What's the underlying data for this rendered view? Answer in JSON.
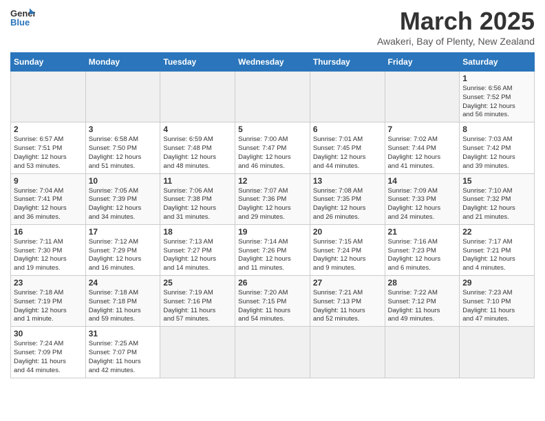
{
  "header": {
    "logo_general": "General",
    "logo_blue": "Blue",
    "month_title": "March 2025",
    "subtitle": "Awakeri, Bay of Plenty, New Zealand"
  },
  "days_of_week": [
    "Sunday",
    "Monday",
    "Tuesday",
    "Wednesday",
    "Thursday",
    "Friday",
    "Saturday"
  ],
  "weeks": [
    [
      {
        "day": "",
        "info": ""
      },
      {
        "day": "",
        "info": ""
      },
      {
        "day": "",
        "info": ""
      },
      {
        "day": "",
        "info": ""
      },
      {
        "day": "",
        "info": ""
      },
      {
        "day": "",
        "info": ""
      },
      {
        "day": "1",
        "info": "Sunrise: 6:56 AM\nSunset: 7:52 PM\nDaylight: 12 hours\nand 56 minutes."
      }
    ],
    [
      {
        "day": "2",
        "info": "Sunrise: 6:57 AM\nSunset: 7:51 PM\nDaylight: 12 hours\nand 53 minutes."
      },
      {
        "day": "3",
        "info": "Sunrise: 6:58 AM\nSunset: 7:50 PM\nDaylight: 12 hours\nand 51 minutes."
      },
      {
        "day": "4",
        "info": "Sunrise: 6:59 AM\nSunset: 7:48 PM\nDaylight: 12 hours\nand 48 minutes."
      },
      {
        "day": "5",
        "info": "Sunrise: 7:00 AM\nSunset: 7:47 PM\nDaylight: 12 hours\nand 46 minutes."
      },
      {
        "day": "6",
        "info": "Sunrise: 7:01 AM\nSunset: 7:45 PM\nDaylight: 12 hours\nand 44 minutes."
      },
      {
        "day": "7",
        "info": "Sunrise: 7:02 AM\nSunset: 7:44 PM\nDaylight: 12 hours\nand 41 minutes."
      },
      {
        "day": "8",
        "info": "Sunrise: 7:03 AM\nSunset: 7:42 PM\nDaylight: 12 hours\nand 39 minutes."
      }
    ],
    [
      {
        "day": "9",
        "info": "Sunrise: 7:04 AM\nSunset: 7:41 PM\nDaylight: 12 hours\nand 36 minutes."
      },
      {
        "day": "10",
        "info": "Sunrise: 7:05 AM\nSunset: 7:39 PM\nDaylight: 12 hours\nand 34 minutes."
      },
      {
        "day": "11",
        "info": "Sunrise: 7:06 AM\nSunset: 7:38 PM\nDaylight: 12 hours\nand 31 minutes."
      },
      {
        "day": "12",
        "info": "Sunrise: 7:07 AM\nSunset: 7:36 PM\nDaylight: 12 hours\nand 29 minutes."
      },
      {
        "day": "13",
        "info": "Sunrise: 7:08 AM\nSunset: 7:35 PM\nDaylight: 12 hours\nand 26 minutes."
      },
      {
        "day": "14",
        "info": "Sunrise: 7:09 AM\nSunset: 7:33 PM\nDaylight: 12 hours\nand 24 minutes."
      },
      {
        "day": "15",
        "info": "Sunrise: 7:10 AM\nSunset: 7:32 PM\nDaylight: 12 hours\nand 21 minutes."
      }
    ],
    [
      {
        "day": "16",
        "info": "Sunrise: 7:11 AM\nSunset: 7:30 PM\nDaylight: 12 hours\nand 19 minutes."
      },
      {
        "day": "17",
        "info": "Sunrise: 7:12 AM\nSunset: 7:29 PM\nDaylight: 12 hours\nand 16 minutes."
      },
      {
        "day": "18",
        "info": "Sunrise: 7:13 AM\nSunset: 7:27 PM\nDaylight: 12 hours\nand 14 minutes."
      },
      {
        "day": "19",
        "info": "Sunrise: 7:14 AM\nSunset: 7:26 PM\nDaylight: 12 hours\nand 11 minutes."
      },
      {
        "day": "20",
        "info": "Sunrise: 7:15 AM\nSunset: 7:24 PM\nDaylight: 12 hours\nand 9 minutes."
      },
      {
        "day": "21",
        "info": "Sunrise: 7:16 AM\nSunset: 7:23 PM\nDaylight: 12 hours\nand 6 minutes."
      },
      {
        "day": "22",
        "info": "Sunrise: 7:17 AM\nSunset: 7:21 PM\nDaylight: 12 hours\nand 4 minutes."
      }
    ],
    [
      {
        "day": "23",
        "info": "Sunrise: 7:18 AM\nSunset: 7:19 PM\nDaylight: 12 hours\nand 1 minute."
      },
      {
        "day": "24",
        "info": "Sunrise: 7:18 AM\nSunset: 7:18 PM\nDaylight: 11 hours\nand 59 minutes."
      },
      {
        "day": "25",
        "info": "Sunrise: 7:19 AM\nSunset: 7:16 PM\nDaylight: 11 hours\nand 57 minutes."
      },
      {
        "day": "26",
        "info": "Sunrise: 7:20 AM\nSunset: 7:15 PM\nDaylight: 11 hours\nand 54 minutes."
      },
      {
        "day": "27",
        "info": "Sunrise: 7:21 AM\nSunset: 7:13 PM\nDaylight: 11 hours\nand 52 minutes."
      },
      {
        "day": "28",
        "info": "Sunrise: 7:22 AM\nSunset: 7:12 PM\nDaylight: 11 hours\nand 49 minutes."
      },
      {
        "day": "29",
        "info": "Sunrise: 7:23 AM\nSunset: 7:10 PM\nDaylight: 11 hours\nand 47 minutes."
      }
    ],
    [
      {
        "day": "30",
        "info": "Sunrise: 7:24 AM\nSunset: 7:09 PM\nDaylight: 11 hours\nand 44 minutes."
      },
      {
        "day": "31",
        "info": "Sunrise: 7:25 AM\nSunset: 7:07 PM\nDaylight: 11 hours\nand 42 minutes."
      },
      {
        "day": "",
        "info": ""
      },
      {
        "day": "",
        "info": ""
      },
      {
        "day": "",
        "info": ""
      },
      {
        "day": "",
        "info": ""
      },
      {
        "day": "",
        "info": ""
      }
    ]
  ]
}
